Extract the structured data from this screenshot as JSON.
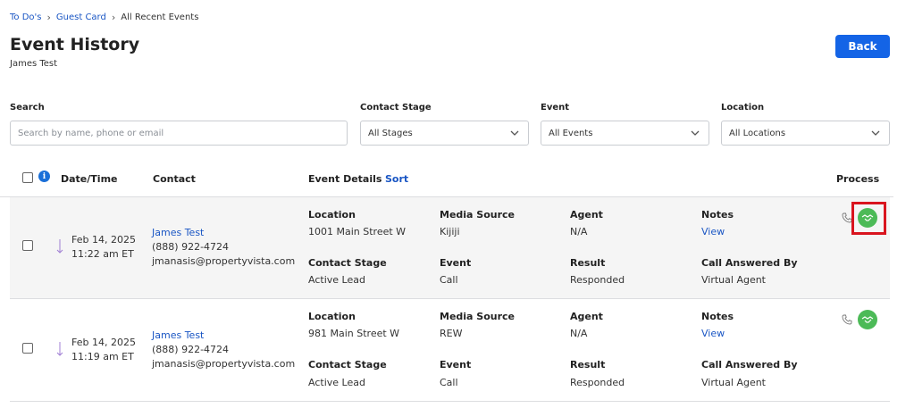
{
  "breadcrumb": {
    "item1": "To Do's",
    "item2": "Guest Card",
    "current": "All Recent Events"
  },
  "page": {
    "title": "Event History",
    "subtitle": "James Test",
    "back_label": "Back"
  },
  "filters": {
    "search_label": "Search",
    "search_placeholder": "Search by name, phone or email",
    "contact_stage_label": "Contact Stage",
    "contact_stage_value": "All Stages",
    "event_label": "Event",
    "event_value": "All Events",
    "location_label": "Location",
    "location_value": "All Locations"
  },
  "table": {
    "headers": {
      "datetime": "Date/Time",
      "contact": "Contact",
      "event_details": "Event Details",
      "sort": "Sort",
      "process": "Process"
    },
    "field_labels": {
      "location": "Location",
      "media_source": "Media Source",
      "agent": "Agent",
      "notes": "Notes",
      "contact_stage": "Contact Stage",
      "event": "Event",
      "result": "Result",
      "call_answered_by": "Call Answered By"
    },
    "rows": [
      {
        "date": "Feb 14, 2025",
        "time": "11:22 am ET",
        "contact_name": "James Test",
        "phone": "(888) 922-4724",
        "email": "jmanasis@propertyvista.com",
        "location": "1001 Main Street W",
        "media_source": "Kijiji",
        "agent": "N/A",
        "notes": "View",
        "contact_stage": "Active Lead",
        "event": "Call",
        "result": "Responded",
        "call_answered_by": "Virtual Agent"
      },
      {
        "date": "Feb 14, 2025",
        "time": "11:19 am ET",
        "contact_name": "James Test",
        "phone": "(888) 922-4724",
        "email": "jmanasis@propertyvista.com",
        "location": "981 Main Street W",
        "media_source": "REW",
        "agent": "N/A",
        "notes": "View",
        "contact_stage": "Active Lead",
        "event": "Call",
        "result": "Responded",
        "call_answered_by": "Virtual Agent"
      }
    ]
  },
  "colors": {
    "accent": "#1464e6",
    "link": "#1a56c4",
    "process_green": "#4cba57",
    "highlight_red": "#d9141e"
  },
  "icons": {
    "breadcrumb_separator": "chevron-right-icon",
    "dropdown": "chevron-down-icon",
    "info": "info-icon",
    "row_event": "arrow-down-icon",
    "call": "phone-icon",
    "process": "handshake-icon"
  }
}
